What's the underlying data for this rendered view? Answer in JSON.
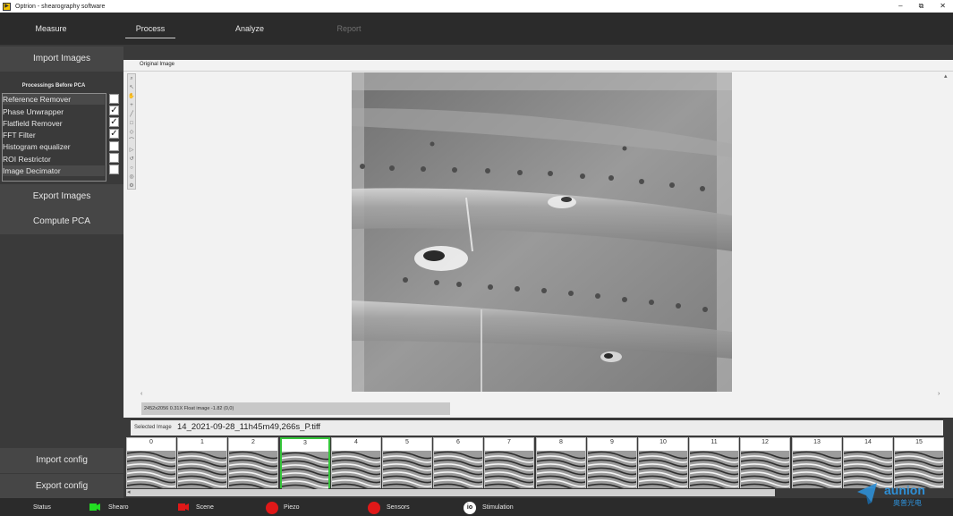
{
  "window": {
    "title": "Optrion - shearography software",
    "app_icon_glyph": "▶"
  },
  "window_controls": {
    "minimize": "–",
    "restore": "⧉",
    "close": "✕"
  },
  "nav": {
    "tabs": [
      {
        "label": "Measure",
        "state": "normal"
      },
      {
        "label": "Process",
        "state": "active"
      },
      {
        "label": "Analyze",
        "state": "normal"
      },
      {
        "label": "Report",
        "state": "disabled"
      }
    ]
  },
  "sidebar": {
    "import_images": "Import Images",
    "processings_title": "Processings Before PCA",
    "processings": [
      {
        "label": "Reference Remover",
        "checked": false
      },
      {
        "label": "Phase Unwrapper",
        "checked": true
      },
      {
        "label": "Flatfield Remover",
        "checked": true
      },
      {
        "label": "FFT Filter",
        "checked": true
      },
      {
        "label": "Histogram equalizer",
        "checked": false
      },
      {
        "label": "ROI Restrictor",
        "checked": false
      },
      {
        "label": "Image Decimator",
        "checked": false
      }
    ],
    "export_images": "Export Images",
    "compute_pca": "Compute PCA",
    "import_config": "Import config",
    "export_config": "Export config"
  },
  "viewer": {
    "tab_label": "Original Image",
    "info": "2452x2056 0.31X Float image -1.82   (0,0)",
    "scroll": {
      "up": "▴",
      "left": "‹",
      "right": "›"
    },
    "tools": [
      "⌕",
      "↖",
      "✋",
      "+",
      "╱",
      "□",
      "◇",
      "⌒",
      "▷",
      "↺",
      "○",
      "◎",
      "⚙"
    ]
  },
  "selected_image": {
    "label": "Selected Image",
    "value": "14_2021-09-28_11h45m49,266s_P.tiff"
  },
  "thumbnails": {
    "labels": [
      "0",
      "1",
      "2",
      "3",
      "4",
      "5",
      "6",
      "7",
      "8",
      "9",
      "10",
      "11",
      "12",
      "13",
      "14",
      "15"
    ],
    "selected_index": 3,
    "scroll_arrow": "◂"
  },
  "status": {
    "label": "Status",
    "items": [
      {
        "name": "Shearo",
        "color": "#22dd22"
      },
      {
        "name": "Scene",
        "color": "#e01818"
      },
      {
        "name": "Piezo",
        "color": "#e01818"
      },
      {
        "name": "Sensors",
        "color": "#e01818"
      },
      {
        "name": "Stimulation",
        "color": "#ffffff"
      }
    ],
    "io_glyph": "io"
  },
  "logo": {
    "text": "aunion",
    "subtext": "奥普光电",
    "color": "#2e8fd6"
  }
}
